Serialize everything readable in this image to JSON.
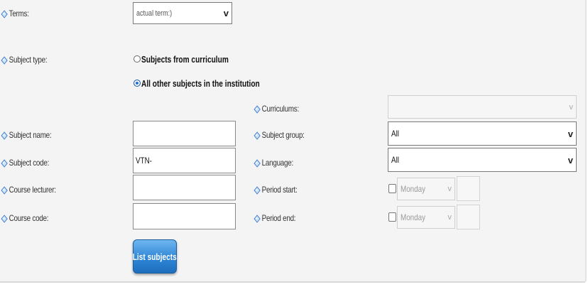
{
  "labels": {
    "terms": "Terms:",
    "subject_type": "Subject type:",
    "curriculums": "Curriculums:",
    "subject_name": "Subject name:",
    "subject_group": "Subject group:",
    "subject_code": "Subject code:",
    "language": "Language:",
    "course_lecturer": "Course lecturer:",
    "period_start": "Period start:",
    "course_code": "Course code:",
    "period_end": "Period end:"
  },
  "terms_select": {
    "value": "actual term:)"
  },
  "subject_type": {
    "option_curriculum": "Subjects from curriculum",
    "option_all_other": "All other subjects in the institution",
    "selected": "All other subjects in the institution"
  },
  "curriculums_select": {
    "value": ""
  },
  "subject_name_value": "",
  "subject_code_value": "VTN-",
  "course_lecturer_value": "",
  "course_code_value": "",
  "subject_group_select": {
    "value": "All"
  },
  "language_select": {
    "value": "All"
  },
  "period_start": {
    "checked": false,
    "day": "Monday"
  },
  "period_end": {
    "checked": false,
    "day": "Monday"
  },
  "buttons": {
    "list_subjects": "List subjects"
  },
  "colors": {
    "accent": "#2f86d6",
    "panel_bg": "#f4f4f4",
    "icon": "#3a78c9"
  },
  "icons": {
    "label_marker": "diamond-bullet-icon",
    "dropdown": "chevron-down-icon"
  }
}
